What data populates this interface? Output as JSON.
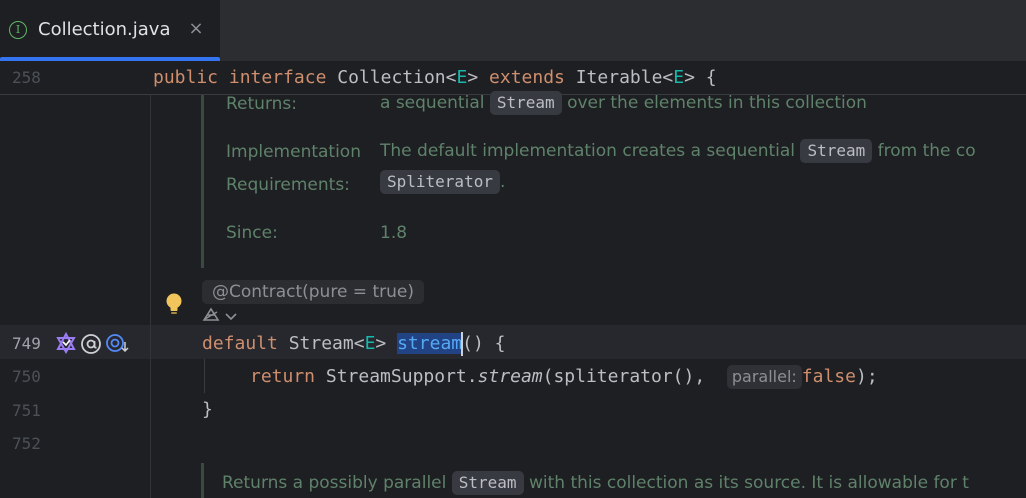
{
  "tab": {
    "icon_letter": "I",
    "title": "Collection.java",
    "close": "×"
  },
  "colors": {
    "accent": "#3574f0",
    "keyword": "#cf8e6d",
    "type_param": "#16baac",
    "doc_text": "#5f826b",
    "selected_text": "#56a8f5"
  },
  "editor": {
    "sticky_line": {
      "number": "258",
      "kw1": "public",
      "kw2": "interface",
      "name": "Collection<",
      "tparam": "E",
      "close": ">",
      "kw3": "extends",
      "iter": "Iterable<",
      "tparam2": "E",
      "tail": "> {"
    },
    "doc1": {
      "returns_label": "Returns:",
      "returns_pre": "a sequential",
      "returns_chip": "Stream",
      "returns_post": "over the elements in this collection",
      "impl_label_1": "Implementation",
      "impl_label_2": "Requirements:",
      "impl_pre": "The default implementation creates a sequential",
      "impl_chip": "Stream",
      "impl_post": "from the co",
      "impl_chip2": "Spliterator",
      "impl_end": ".",
      "since_label": "Since:",
      "since_value": "1.8"
    },
    "annotation": "@Contract(pure = true)",
    "lines": {
      "l749": {
        "number": "749",
        "kw": "default",
        "type": "Stream<",
        "tparam": "E",
        "close": ">",
        "method": "stream",
        "tail": "() {"
      },
      "l750": {
        "number": "750",
        "kw": "return",
        "call": "StreamSupport.",
        "method": "stream",
        "args": "(spliterator(),",
        "hint": "parallel:",
        "value": "false",
        "end": ");"
      },
      "l751": {
        "number": "751",
        "text": "}"
      },
      "l752": {
        "number": "752"
      }
    },
    "doc2": {
      "pre": "Returns a possibly parallel",
      "chip": "Stream",
      "post": "with this collection as its source. It is allowable for t"
    },
    "gutter_icons": [
      "bulb-icon",
      "ai-assistant-icon",
      "chevron-down-icon",
      "implement-icon",
      "annotation-icon",
      "overrides-icon"
    ]
  }
}
